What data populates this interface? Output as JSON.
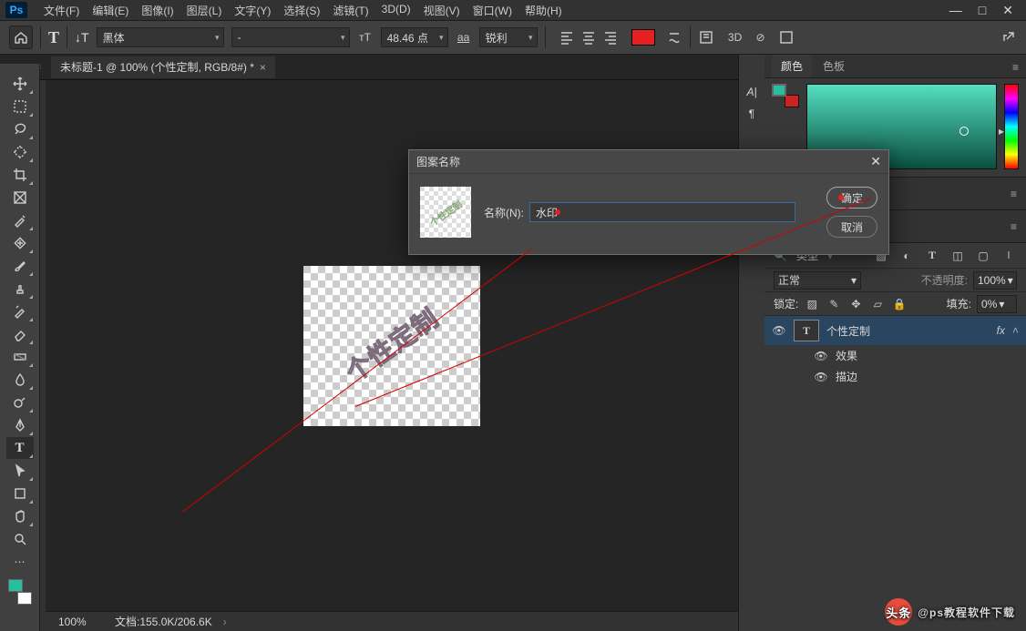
{
  "app": {
    "logo": "Ps"
  },
  "menu": [
    "文件(F)",
    "编辑(E)",
    "图像(I)",
    "图层(L)",
    "文字(Y)",
    "选择(S)",
    "滤镜(T)",
    "3D(D)",
    "视图(V)",
    "窗口(W)",
    "帮助(H)"
  ],
  "options": {
    "font_family": "黑体",
    "font_style": "-",
    "font_size": "48.46 点",
    "aa_label": "aa",
    "aa_value": "锐利",
    "three_d": "3D"
  },
  "docTab": {
    "title": "未标题-1 @ 100% (个性定制, RGB/8#) *"
  },
  "canvas": {
    "watermark": "个性定制"
  },
  "status": {
    "zoom": "100%",
    "doc": "文档:155.0K/206.6K"
  },
  "typePanel": {
    "char": "A|",
    "para": "¶"
  },
  "colorPanel": {
    "tab_color": "颜色",
    "tab_swatch": "色板"
  },
  "layers": {
    "search_label": "类型",
    "blend": "正常",
    "opacity_label": "不透明度:",
    "opacity_value": "100%",
    "lock_label": "锁定:",
    "fill_label": "填充:",
    "fill_value": "0%",
    "item_name": "个性定制",
    "fx": "fx",
    "effects": "效果",
    "stroke": "描边"
  },
  "dialog": {
    "title": "图案名称",
    "name_label": "名称(N):",
    "name_value": "水印",
    "ok": "确定",
    "cancel": "取消"
  },
  "credit": {
    "prefix": "头条",
    "handle": "@ps教程软件下载"
  }
}
